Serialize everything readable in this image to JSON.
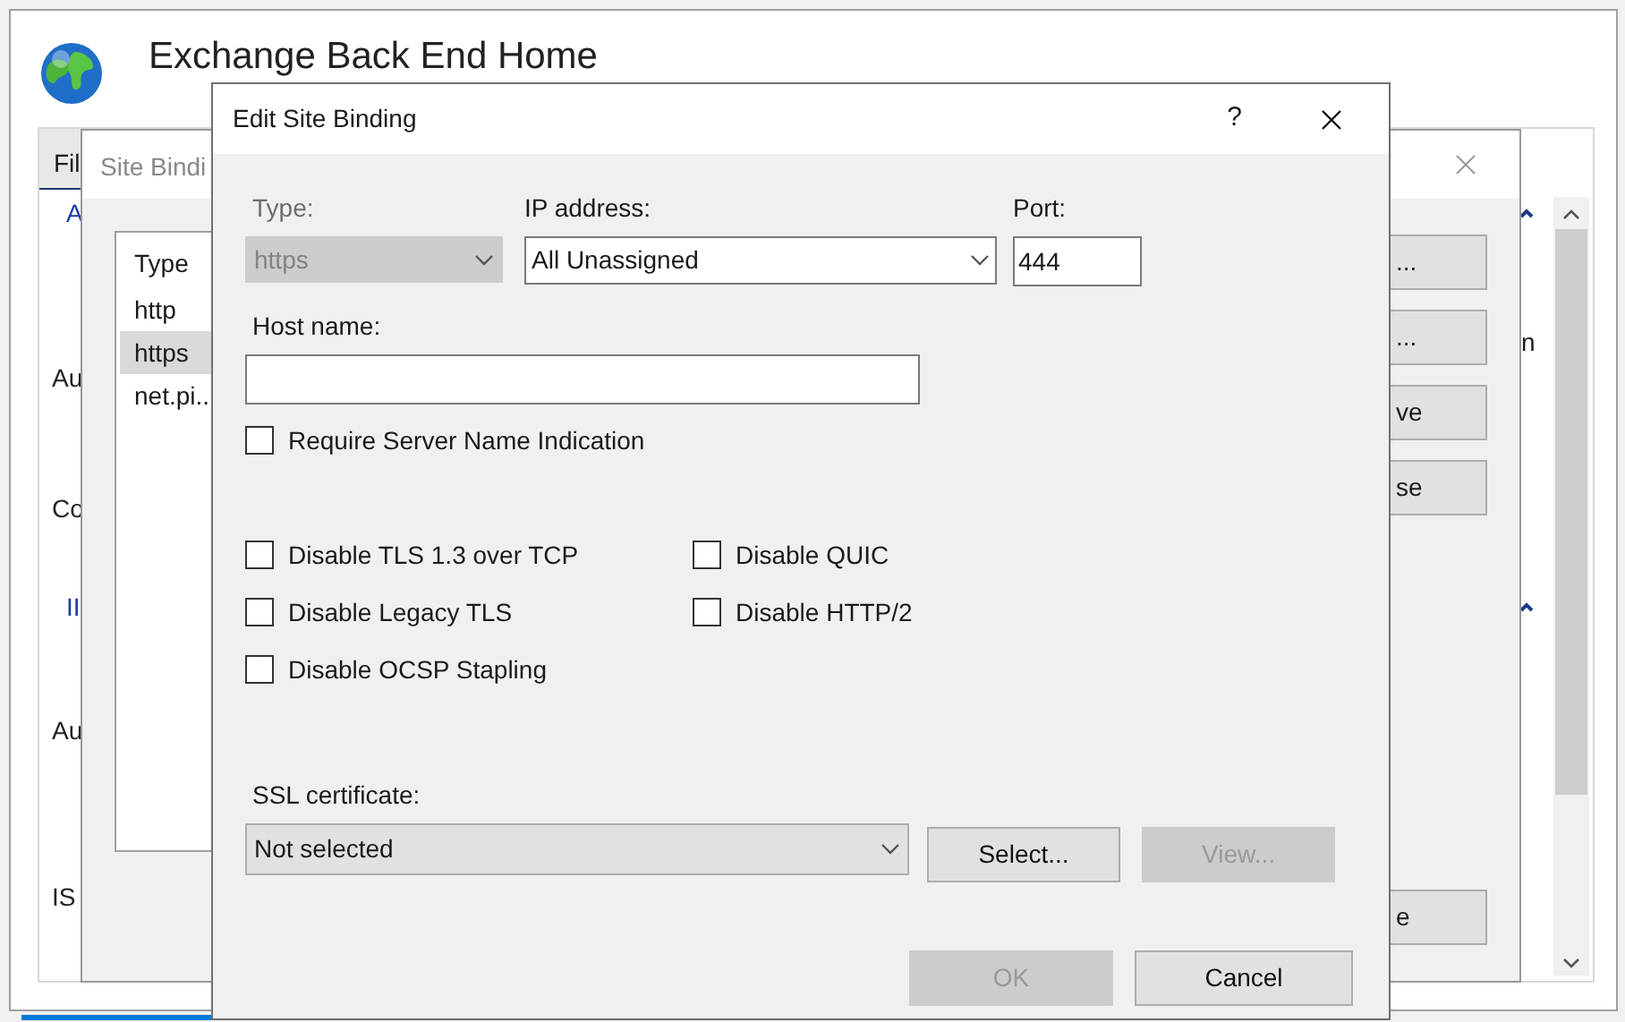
{
  "main_window": {
    "title": "Exchange Back End Home",
    "tab": "Fil",
    "labels": [
      {
        "text": "A",
        "kind": "link"
      },
      {
        "text": "Au",
        "kind": "plain"
      },
      {
        "text": "Co",
        "kind": "plain"
      },
      {
        "text": "II",
        "kind": "link"
      },
      {
        "text": "Au",
        "kind": "plain"
      },
      {
        "text": "IS",
        "kind": "plain"
      }
    ],
    "side_text": "n"
  },
  "site_bindings": {
    "title": "Site Bindi",
    "list_header": "Type",
    "rows": [
      {
        "text": "http",
        "selected": false
      },
      {
        "text": "https",
        "selected": true
      },
      {
        "text": "net.pi..",
        "selected": false
      }
    ],
    "buttons": [
      "...",
      "...",
      "ve",
      "se",
      "e"
    ]
  },
  "edit_dialog": {
    "title": "Edit Site Binding",
    "help": "?",
    "type": {
      "label": "Type:",
      "value": "https",
      "disabled": true
    },
    "ip_address": {
      "label": "IP address:",
      "value": "All Unassigned"
    },
    "port": {
      "label": "Port:",
      "value": "444"
    },
    "host_name": {
      "label": "Host name:"
    },
    "sni": {
      "label": "Require Server Name Indication",
      "checked": false
    },
    "options": [
      {
        "label": "Disable TLS 1.3 over TCP",
        "checked": false
      },
      {
        "label": "Disable QUIC",
        "checked": false
      },
      {
        "label": "Disable Legacy TLS",
        "checked": false
      },
      {
        "label": "Disable HTTP/2",
        "checked": false
      },
      {
        "label": "Disable OCSP Stapling",
        "checked": false
      }
    ],
    "ssl_certificate": {
      "label": "SSL certificate:",
      "value": "Not selected"
    },
    "buttons": [
      {
        "label": "Select...",
        "disabled": false
      },
      {
        "label": "View...",
        "disabled": true
      },
      {
        "label": "OK",
        "disabled": true
      },
      {
        "label": "Cancel",
        "disabled": false
      }
    ]
  }
}
